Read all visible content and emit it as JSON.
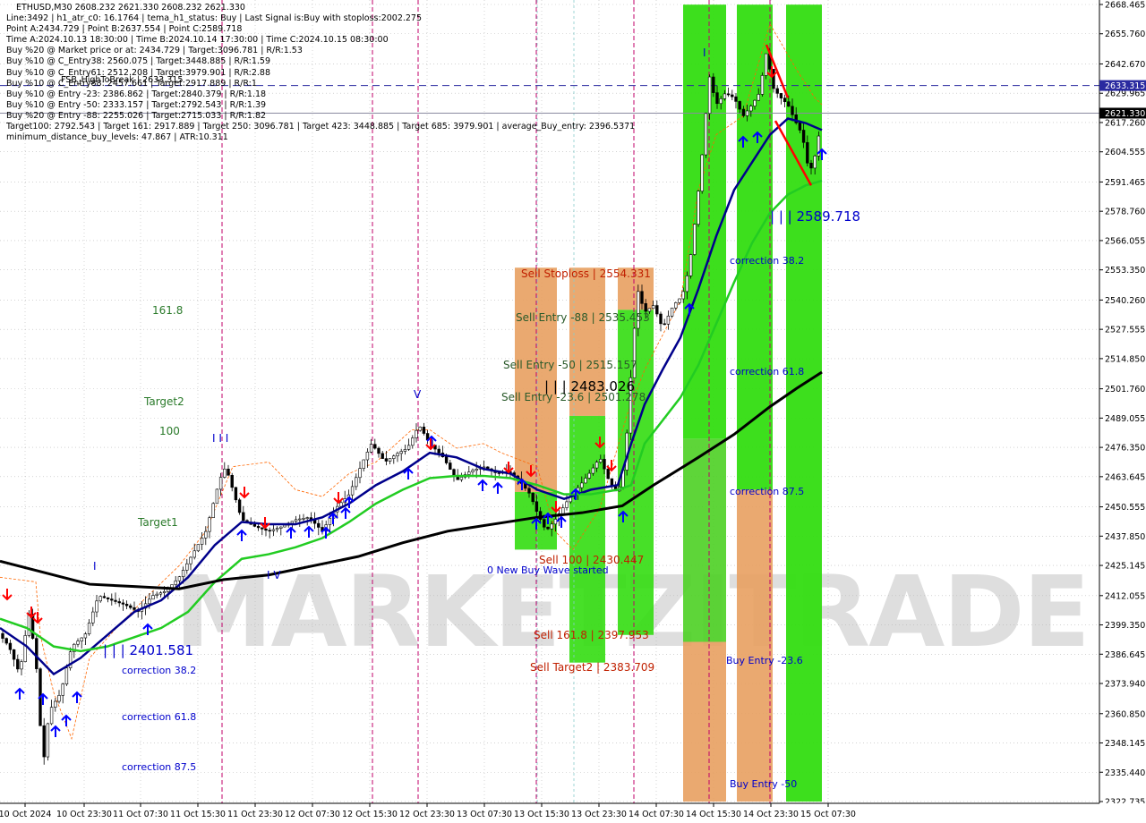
{
  "header": {
    "symbol_line": "ETHUSD,M30  2608.232 2621.330 2608.232 2621.330",
    "info_lines": [
      "Line:3492 | h1_atr_c0: 16.1764 | tema_h1_status: Buy | Last Signal is:Buy with stoploss:2002.275",
      "Point A:2434.729 | Point B:2637.554 | Point C:2589.718",
      "Time A:2024.10.13 18:30:00 | Time B:2024.10.14 17:30:00 | Time C:2024.10.15 08:30:00",
      "Buy %20 @ Market price or at: 2434.729 | Target:3096.781 | R/R:1.53",
      "Buy %10 @ C_Entry38: 2560.075 | Target:3448.885 | R/R:1.59",
      "Buy %10 @ C_Entry61: 2512.208 | Target:3979.901 | R/R:2.88",
      "Buy %10 @ C_Entry88: 2457.661 | Target:2917.889 | R/R:1",
      "Buy %10 @ Entry -23: 2386.862 | Target:2840.379 | R/R:1.18",
      "Buy %10 @ Entry -50: 2333.157 | Target:2792.543 | R/R:1.39",
      "Buy %20 @ Entry -88: 2255.026 | Target:2715.033 | R/R:1.82",
      "Target100: 2792.543 | Target 161: 2917.889 | Target 250: 3096.781 | Target 423: 3448.885 | Target 685: 3979.901 | average_Buy_entry: 2396.5371",
      "minimum_distance_buy_levels: 47.867 | ATR:10.311"
    ],
    "overlap_text": "FSB_HighToBreak | 2633.315"
  },
  "watermark": "MARKETZITRADE",
  "price_labels": {
    "current": "2621.330",
    "high_line": "2633.315"
  },
  "annotations": {
    "sell_stoploss": "Sell Stoploss | 2554.331",
    "sell_entry_88": "Sell Entry -88 | 2535.453",
    "sell_entry_50": "Sell Entry -50 | 2515.157",
    "sell_entry_23": "Sell Entry -23.6 | 2501.278",
    "level_2483": "| | | 2483.026",
    "sell_100": "Sell 100 | 2430.447",
    "new_buy_wave": "0 New Buy Wave started",
    "sell_161": "Sell 161.8 | 2397.953",
    "sell_target2": "Sell Target2 | 2383.709",
    "level_2589": "| | | 2589.718",
    "level_2401": "| | | 2401.581",
    "left_correction_382": "correction 38.2",
    "left_correction_618": "correction 61.8",
    "left_correction_875": "correction 87.5",
    "right_correction_382": "correction 38.2",
    "right_correction_618": "correction 61.8",
    "right_correction_875": "correction 87.5",
    "buy_entry_236": "Buy Entry -23.6",
    "buy_entry_50": "Buy Entry -50",
    "fib_1618": "161.8",
    "target2": "Target2",
    "fib_100": "100",
    "target1": "Target1",
    "wave_iii": "I I I",
    "wave_i": "I",
    "wave_iv": "I V",
    "wave_v": "V",
    "wave_i_right": "I"
  },
  "colors": {
    "background": "#ffffff",
    "grid": "#b8b8b8",
    "bright_green": "#33dd11",
    "orange": "#e8a060",
    "blue_ma": "#00008b",
    "green_ma": "#22cc22",
    "black_ma": "#000000",
    "magenta": "#c0006a",
    "arrow_up": "#0000ff",
    "arrow_down": "#ff0000",
    "text_blue": "#0000cc",
    "text_red": "#c02000",
    "text_green": "#2a7a2a"
  },
  "chart_data": {
    "type": "candlestick",
    "symbol": "ETHUSD",
    "timeframe": "M30",
    "x_tick_labels": [
      "10 Oct 2024",
      "10 Oct 23:30",
      "11 Oct 07:30",
      "11 Oct 15:30",
      "11 Oct 23:30",
      "12 Oct 07:30",
      "12 Oct 15:30",
      "12 Oct 23:30",
      "13 Oct 07:30",
      "13 Oct 15:30",
      "13 Oct 23:30",
      "14 Oct 07:30",
      "14 Oct 15:30",
      "14 Oct 23:30",
      "15 Oct 07:30"
    ],
    "y_tick_labels": [
      "2668.465",
      "2655.760",
      "2642.670",
      "2629.965",
      "2617.260",
      "2604.555",
      "2591.465",
      "2578.760",
      "2566.055",
      "2553.350",
      "2540.260",
      "2527.555",
      "2514.850",
      "2501.760",
      "2489.055",
      "2476.350",
      "2463.645",
      "2450.555",
      "2437.850",
      "2425.145",
      "2412.055",
      "2399.350",
      "2386.645",
      "2373.940",
      "2360.850",
      "2348.145",
      "2335.440",
      "2322.735"
    ],
    "ylim": [
      2322.735,
      2668.465
    ],
    "price_path": [
      [
        0,
        2395
      ],
      [
        10,
        2390
      ],
      [
        22,
        2378
      ],
      [
        32,
        2405
      ],
      [
        40,
        2385
      ],
      [
        48,
        2338
      ],
      [
        55,
        2362
      ],
      [
        68,
        2370
      ],
      [
        80,
        2390
      ],
      [
        95,
        2395
      ],
      [
        110,
        2412
      ],
      [
        125,
        2410
      ],
      [
        140,
        2408
      ],
      [
        155,
        2405
      ],
      [
        170,
        2412
      ],
      [
        185,
        2414
      ],
      [
        200,
        2420
      ],
      [
        215,
        2430
      ],
      [
        230,
        2440
      ],
      [
        245,
        2462
      ],
      [
        252,
        2468
      ],
      [
        260,
        2458
      ],
      [
        270,
        2445
      ],
      [
        285,
        2442
      ],
      [
        300,
        2440
      ],
      [
        315,
        2442
      ],
      [
        330,
        2445
      ],
      [
        345,
        2446
      ],
      [
        360,
        2440
      ],
      [
        375,
        2450
      ],
      [
        390,
        2456
      ],
      [
        405,
        2470
      ],
      [
        415,
        2478
      ],
      [
        430,
        2470
      ],
      [
        445,
        2474
      ],
      [
        455,
        2476
      ],
      [
        468,
        2486
      ],
      [
        480,
        2478
      ],
      [
        495,
        2472
      ],
      [
        510,
        2462
      ],
      [
        525,
        2466
      ],
      [
        540,
        2468
      ],
      [
        555,
        2465
      ],
      [
        568,
        2466
      ],
      [
        580,
        2462
      ],
      [
        592,
        2456
      ],
      [
        600,
        2448
      ],
      [
        610,
        2440
      ],
      [
        622,
        2446
      ],
      [
        635,
        2454
      ],
      [
        648,
        2460
      ],
      [
        660,
        2466
      ],
      [
        670,
        2472
      ],
      [
        680,
        2462
      ],
      [
        690,
        2456
      ],
      [
        698,
        2470
      ],
      [
        705,
        2510
      ],
      [
        712,
        2545
      ],
      [
        720,
        2535
      ],
      [
        730,
        2538
      ],
      [
        740,
        2528
      ],
      [
        752,
        2538
      ],
      [
        762,
        2542
      ],
      [
        770,
        2555
      ],
      [
        778,
        2580
      ],
      [
        786,
        2610
      ],
      [
        792,
        2638
      ],
      [
        800,
        2625
      ],
      [
        810,
        2630
      ],
      [
        820,
        2628
      ],
      [
        830,
        2620
      ],
      [
        840,
        2625
      ],
      [
        848,
        2630
      ],
      [
        856,
        2648
      ],
      [
        864,
        2632
      ],
      [
        872,
        2628
      ],
      [
        880,
        2625
      ],
      [
        888,
        2618
      ],
      [
        896,
        2612
      ],
      [
        904,
        2595
      ],
      [
        912,
        2605
      ],
      [
        918,
        2621
      ]
    ],
    "series": [
      {
        "name": "",
        "color": "#00008b",
        "points": [
          [
            0,
            2398
          ],
          [
            30,
            2390
          ],
          [
            60,
            2378
          ],
          [
            90,
            2385
          ],
          [
            120,
            2395
          ],
          [
            150,
            2405
          ],
          [
            180,
            2410
          ],
          [
            210,
            2420
          ],
          [
            240,
            2434
          ],
          [
            270,
            2444
          ],
          [
            300,
            2443
          ],
          [
            330,
            2443
          ],
          [
            360,
            2446
          ],
          [
            390,
            2452
          ],
          [
            420,
            2460
          ],
          [
            450,
            2466
          ],
          [
            480,
            2474
          ],
          [
            510,
            2472
          ],
          [
            540,
            2467
          ],
          [
            570,
            2465
          ],
          [
            600,
            2458
          ],
          [
            630,
            2454
          ],
          [
            660,
            2458
          ],
          [
            690,
            2460
          ],
          [
            705,
            2478
          ],
          [
            720,
            2495
          ],
          [
            740,
            2510
          ],
          [
            760,
            2524
          ],
          [
            780,
            2545
          ],
          [
            800,
            2568
          ],
          [
            820,
            2588
          ],
          [
            840,
            2600
          ],
          [
            860,
            2612
          ],
          [
            880,
            2619
          ],
          [
            900,
            2617
          ],
          [
            918,
            2614
          ]
        ]
      },
      {
        "name": "",
        "color": "#22cc22",
        "points": [
          [
            0,
            2402
          ],
          [
            30,
            2398
          ],
          [
            60,
            2390
          ],
          [
            90,
            2388
          ],
          [
            120,
            2390
          ],
          [
            150,
            2394
          ],
          [
            180,
            2398
          ],
          [
            210,
            2405
          ],
          [
            240,
            2418
          ],
          [
            270,
            2428
          ],
          [
            300,
            2430
          ],
          [
            330,
            2433
          ],
          [
            360,
            2437
          ],
          [
            390,
            2444
          ],
          [
            420,
            2452
          ],
          [
            450,
            2458
          ],
          [
            480,
            2463
          ],
          [
            510,
            2464
          ],
          [
            540,
            2464
          ],
          [
            570,
            2463
          ],
          [
            600,
            2460
          ],
          [
            630,
            2456
          ],
          [
            660,
            2456
          ],
          [
            690,
            2458
          ],
          [
            705,
            2460
          ],
          [
            720,
            2478
          ],
          [
            740,
            2488
          ],
          [
            760,
            2498
          ],
          [
            780,
            2512
          ],
          [
            800,
            2530
          ],
          [
            820,
            2548
          ],
          [
            840,
            2565
          ],
          [
            860,
            2578
          ],
          [
            880,
            2586
          ],
          [
            900,
            2590
          ],
          [
            918,
            2592
          ]
        ]
      },
      {
        "name": "",
        "color": "#000000",
        "points": [
          [
            0,
            2427
          ],
          [
            50,
            2422
          ],
          [
            100,
            2417
          ],
          [
            150,
            2416
          ],
          [
            200,
            2415
          ],
          [
            250,
            2419
          ],
          [
            300,
            2421
          ],
          [
            350,
            2425
          ],
          [
            400,
            2429
          ],
          [
            450,
            2435
          ],
          [
            500,
            2440
          ],
          [
            550,
            2443
          ],
          [
            600,
            2446
          ],
          [
            650,
            2448
          ],
          [
            695,
            2451
          ],
          [
            730,
            2460
          ],
          [
            780,
            2472
          ],
          [
            820,
            2482
          ],
          [
            860,
            2494
          ],
          [
            890,
            2502
          ],
          [
            918,
            2509
          ]
        ]
      }
    ],
    "levels": [
      {
        "label": "FSB_HighToBreak",
        "value": 2633.315,
        "style": "dashed"
      },
      {
        "label": "current",
        "value": 2621.33,
        "style": "solid"
      }
    ]
  }
}
